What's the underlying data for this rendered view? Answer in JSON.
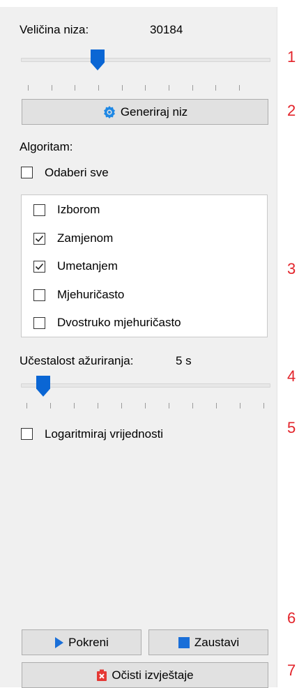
{
  "array_size": {
    "label": "Veličina niza:",
    "value": "30184",
    "slider_fraction": 0.31,
    "tick_count": 10
  },
  "generate_button": {
    "label": "Generiraj niz",
    "icon": "gear-icon"
  },
  "algorithm": {
    "label": "Algoritam:",
    "select_all": {
      "label": "Odaberi sve",
      "checked": false
    },
    "items": [
      {
        "label": "Izborom",
        "checked": false
      },
      {
        "label": "Zamjenom",
        "checked": true
      },
      {
        "label": "Umetanjem",
        "checked": true
      },
      {
        "label": "Mjehuričasto",
        "checked": false
      },
      {
        "label": "Dvostruko mjehuričasto",
        "checked": false
      }
    ]
  },
  "update_frequency": {
    "label": "Učestalost ažuriranja:",
    "value": "5 s",
    "slider_fraction": 0.09,
    "tick_count": 11
  },
  "log_values": {
    "label": "Logaritmiraj vrijednosti",
    "checked": false
  },
  "run_button": {
    "label": "Pokreni",
    "icon": "play-icon",
    "color": "#1a6fd8"
  },
  "stop_button": {
    "label": "Zaustavi",
    "icon": "stop-icon",
    "color": "#1a6fd8"
  },
  "clear_button": {
    "label": "Očisti izvještaje",
    "icon": "clear-report-icon",
    "color": "#e53935"
  },
  "callouts": [
    "1",
    "2",
    "3",
    "4",
    "5",
    "6",
    "7"
  ],
  "colors": {
    "accent": "#0a66d4",
    "callout": "#e3242b",
    "panel": "#f0f0f0"
  }
}
